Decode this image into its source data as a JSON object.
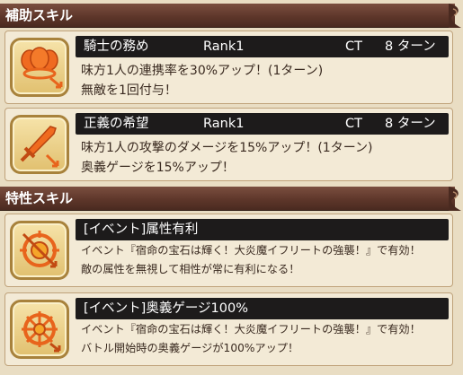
{
  "sections": [
    {
      "title": "補助スキル"
    },
    {
      "title": "特性スキル"
    }
  ],
  "support_skills": [
    {
      "name": "騎士の務め",
      "rank": "Rank1",
      "ct_label": "CT",
      "turns": "8 ターン",
      "desc": [
        "味方1人の連携率を30%アップ！(1ターン)",
        "無敵を1回付与！"
      ],
      "icon": "triple-shield-icon"
    },
    {
      "name": "正義の希望",
      "rank": "Rank1",
      "ct_label": "CT",
      "turns": "8 ターン",
      "desc": [
        "味方1人の攻撃のダメージを15%アップ！(1ターン)",
        "奥義ゲージを15%アップ！"
      ],
      "icon": "sword-up-icon"
    }
  ],
  "traits": [
    {
      "name": "[イベント]属性有利",
      "desc": [
        "イベント『宿命の宝石は輝く！大炎魔イフリートの強襲！』で有効！",
        "敵の属性を無視して相性が常に有利になる！"
      ],
      "icon": "element-advantage-icon"
    },
    {
      "name": "[イベント]奥義ゲージ100%",
      "desc": [
        "イベント『宿命の宝石は輝く！大炎魔イフリートの強襲！』で有効！",
        "バトル開始時の奥義ゲージが100%アップ！"
      ],
      "icon": "gauge-burst-icon"
    }
  ],
  "colors": {
    "header": "#5c3529",
    "title_bar": "#1d1b1b",
    "card": "#f3ead6",
    "icon_orange": "#e8641c"
  }
}
